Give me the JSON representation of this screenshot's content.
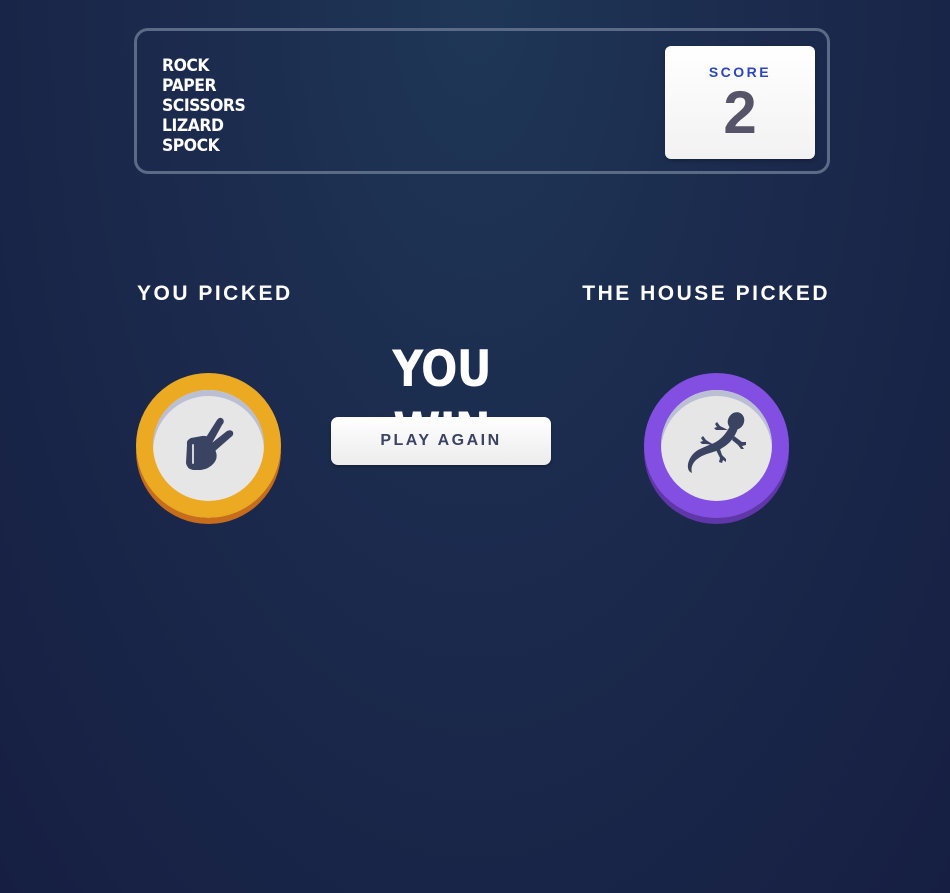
{
  "header": {
    "logo_words": [
      "ROCK",
      "PAPER",
      "SCISSORS",
      "LIZARD",
      "SPOCK"
    ],
    "score_label": "SCORE",
    "score_value": "2"
  },
  "game": {
    "you_picked_label": "YOU PICKED",
    "house_picked_label": "THE HOUSE PICKED",
    "player_choice": "scissors",
    "house_choice": "lizard",
    "result_text": "YOU WIN",
    "play_again_label": "PLAY AGAIN"
  },
  "colors": {
    "scissors_ring": "#eca922",
    "lizard_ring": "#834fe3",
    "score_label": "#2a46c0",
    "score_value": "#565468",
    "icon": "#3b4363"
  },
  "icons": {
    "player_icon": "scissors-hand-icon",
    "house_icon": "lizard-icon"
  }
}
